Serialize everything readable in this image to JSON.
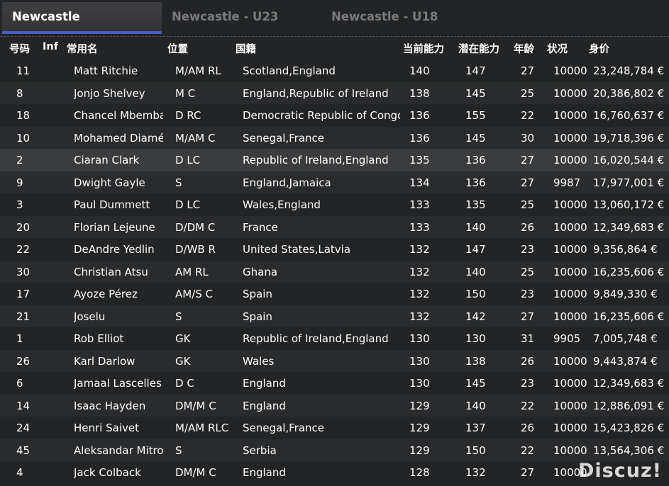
{
  "tabs": [
    {
      "label": "Newcastle",
      "active": true
    },
    {
      "label": "Newcastle - U23",
      "active": false
    },
    {
      "label": "Newcastle - U18",
      "active": false
    }
  ],
  "columns": {
    "number": "号码",
    "inf": "Inf",
    "name": "常用名",
    "position": "位置",
    "nationality": "国籍",
    "ca": "当前能力",
    "pa": "潜在能力",
    "age": "年龄",
    "condition": "状况",
    "value": "身价"
  },
  "rows": [
    {
      "number": "11",
      "inf": "",
      "name": "Matt Ritchie",
      "position": "M/AM RL",
      "nationality": "Scotland,England",
      "ca": "140",
      "pa": "147",
      "age": "27",
      "condition": "10000",
      "value": "23,248,784 €"
    },
    {
      "number": "8",
      "inf": "",
      "name": "Jonjo Shelvey",
      "position": "M C",
      "nationality": "England,Republic of Ireland",
      "ca": "138",
      "pa": "145",
      "age": "25",
      "condition": "10000",
      "value": "20,386,802 €"
    },
    {
      "number": "18",
      "inf": "",
      "name": "Chancel Mbemba",
      "position": "D RC",
      "nationality": "Democratic Republic of Congo",
      "ca": "136",
      "pa": "155",
      "age": "22",
      "condition": "10000",
      "value": "16,760,637 €"
    },
    {
      "number": "10",
      "inf": "",
      "name": "Mohamed Diamé",
      "position": "M/AM C",
      "nationality": "Senegal,France",
      "ca": "136",
      "pa": "145",
      "age": "30",
      "condition": "10000",
      "value": "19,718,396 €"
    },
    {
      "number": "2",
      "inf": "",
      "name": "Ciaran Clark",
      "position": "D LC",
      "nationality": "Republic of Ireland,England",
      "ca": "135",
      "pa": "136",
      "age": "27",
      "condition": "10000",
      "value": "16,020,544 €",
      "selected": true
    },
    {
      "number": "9",
      "inf": "",
      "name": "Dwight Gayle",
      "position": "S",
      "nationality": "England,Jamaica",
      "ca": "134",
      "pa": "136",
      "age": "27",
      "condition": "9987",
      "value": "17,977,001 €"
    },
    {
      "number": "3",
      "inf": "",
      "name": "Paul Dummett",
      "position": "D LC",
      "nationality": "Wales,England",
      "ca": "133",
      "pa": "135",
      "age": "25",
      "condition": "10000",
      "value": "13,060,172 €"
    },
    {
      "number": "20",
      "inf": "",
      "name": "Florian Lejeune",
      "position": "D/DM C",
      "nationality": "France",
      "ca": "133",
      "pa": "140",
      "age": "26",
      "condition": "10000",
      "value": "12,349,683 €"
    },
    {
      "number": "22",
      "inf": "",
      "name": "DeAndre Yedlin",
      "position": "D/WB R",
      "nationality": "United States,Latvia",
      "ca": "132",
      "pa": "147",
      "age": "23",
      "condition": "10000",
      "value": "9,356,864 €"
    },
    {
      "number": "30",
      "inf": "",
      "name": "Christian Atsu",
      "position": "AM RL",
      "nationality": "Ghana",
      "ca": "132",
      "pa": "140",
      "age": "25",
      "condition": "10000",
      "value": "16,235,606 €"
    },
    {
      "number": "17",
      "inf": "",
      "name": "Ayoze Pérez",
      "position": "AM/S C",
      "nationality": "Spain",
      "ca": "132",
      "pa": "150",
      "age": "23",
      "condition": "10000",
      "value": "9,849,330 €"
    },
    {
      "number": "21",
      "inf": "",
      "name": "Joselu",
      "position": "S",
      "nationality": "Spain",
      "ca": "132",
      "pa": "142",
      "age": "27",
      "condition": "10000",
      "value": "16,235,606 €"
    },
    {
      "number": "1",
      "inf": "",
      "name": "Rob Elliot",
      "position": "GK",
      "nationality": "Republic of Ireland,England",
      "ca": "130",
      "pa": "130",
      "age": "31",
      "condition": "9905",
      "value": "7,005,748 €"
    },
    {
      "number": "26",
      "inf": "",
      "name": "Karl Darlow",
      "position": "GK",
      "nationality": "Wales",
      "ca": "130",
      "pa": "138",
      "age": "26",
      "condition": "10000",
      "value": "9,443,874 €"
    },
    {
      "number": "6",
      "inf": "",
      "name": "Jamaal Lascelles",
      "position": "D C",
      "nationality": "England",
      "ca": "130",
      "pa": "145",
      "age": "23",
      "condition": "10000",
      "value": "12,349,683 €"
    },
    {
      "number": "14",
      "inf": "",
      "name": "Isaac Hayden",
      "position": "DM/M C",
      "nationality": "England",
      "ca": "129",
      "pa": "140",
      "age": "22",
      "condition": "10000",
      "value": "12,886,091 €"
    },
    {
      "number": "24",
      "inf": "",
      "name": "Henri Saivet",
      "position": "M/AM RLC",
      "nationality": "Senegal,France",
      "ca": "129",
      "pa": "137",
      "age": "26",
      "condition": "10000",
      "value": "15,423,826 €"
    },
    {
      "number": "45",
      "inf": "",
      "name": "Aleksandar Mitrovic",
      "position": "S",
      "nationality": "Serbia",
      "ca": "129",
      "pa": "150",
      "age": "22",
      "condition": "10000",
      "value": "13,564,306 €"
    },
    {
      "number": "4",
      "inf": "",
      "name": "Jack Colback",
      "position": "DM/M C",
      "nationality": "England",
      "ca": "128",
      "pa": "132",
      "age": "27",
      "condition": "10000",
      "value": ""
    }
  ],
  "watermark": "Discuz!",
  "colors": {
    "background": "#232425",
    "active_tab_underline": "#4a5cc6",
    "selected_row": "#3b3c3e",
    "text": "#ffffff",
    "inactive_tab_text": "#7a7b7c"
  }
}
